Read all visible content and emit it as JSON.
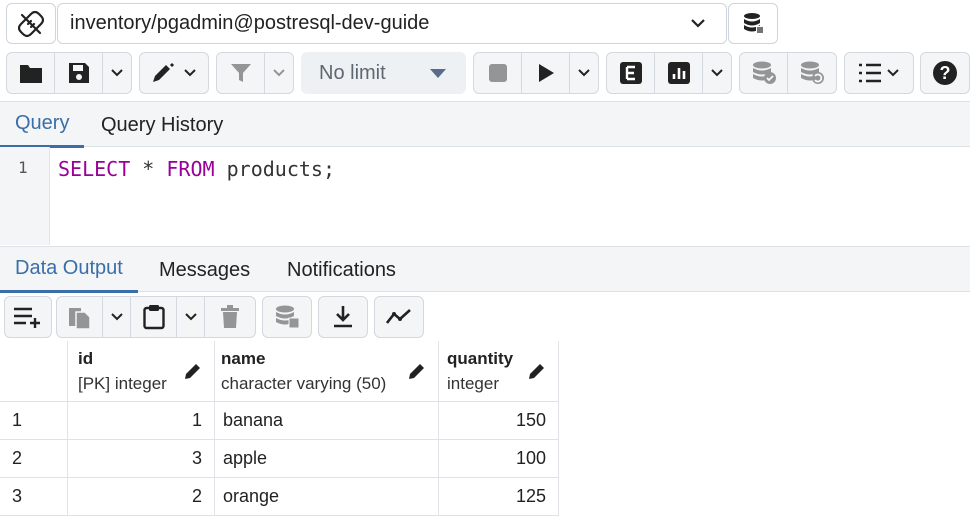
{
  "connection": {
    "label": "inventory/pgadmin@postresql-dev-guide"
  },
  "toolbar": {
    "limit_label": "No limit",
    "icons": [
      "folder-open-icon",
      "save-icon",
      "chevron-down-icon",
      "pencil-edit-icon",
      "filter-icon",
      "stop-icon",
      "play-icon",
      "explain-icon",
      "explain-analyze-icon",
      "commit-icon",
      "rollback-icon",
      "macros-icon",
      "help-icon"
    ]
  },
  "editor_tabs": [
    {
      "label": "Query",
      "active": true
    },
    {
      "label": "Query History",
      "active": false
    }
  ],
  "editor": {
    "line_number": "1",
    "keyword_select": "SELECT",
    "star": "*",
    "keyword_from": "FROM",
    "table": "products;"
  },
  "output_tabs": [
    {
      "label": "Data Output",
      "active": true
    },
    {
      "label": "Messages",
      "active": false
    },
    {
      "label": "Notifications",
      "active": false
    }
  ],
  "grid": {
    "columns": [
      {
        "name": "id",
        "type": "[PK] integer"
      },
      {
        "name": "name",
        "type": "character varying (50)"
      },
      {
        "name": "quantity",
        "type": "integer"
      }
    ],
    "rows": [
      {
        "row": "1",
        "id": "1",
        "name": "banana",
        "quantity": "150"
      },
      {
        "row": "2",
        "id": "3",
        "name": "apple",
        "quantity": "100"
      },
      {
        "row": "3",
        "id": "2",
        "name": "orange",
        "quantity": "125"
      }
    ]
  },
  "colors": {
    "accent": "#3a6ea8",
    "keyword": "#990099",
    "toolbar_bg": "#f3f5f7"
  }
}
